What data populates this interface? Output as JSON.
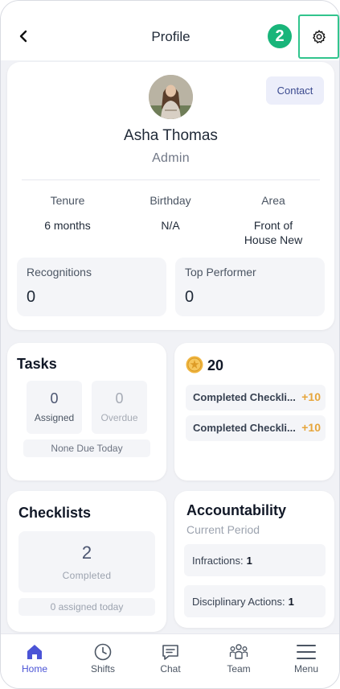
{
  "header": {
    "title": "Profile",
    "step_badge": "2",
    "back_icon": "chevron-left-icon",
    "settings_icon": "gear-icon"
  },
  "profile": {
    "name": "Asha Thomas",
    "role": "Admin",
    "contact_label": "Contact",
    "info": [
      {
        "label": "Tenure",
        "value": "6 months"
      },
      {
        "label": "Birthday",
        "value": "N/A"
      },
      {
        "label": "Area",
        "value": "Front of House New"
      }
    ],
    "stats": [
      {
        "label": "Recognitions",
        "value": "0"
      },
      {
        "label": "Top Performer",
        "value": "0"
      }
    ]
  },
  "tasks": {
    "title": "Tasks",
    "assigned": {
      "value": "0",
      "label": "Assigned"
    },
    "overdue": {
      "value": "0",
      "label": "Overdue"
    },
    "none_due": "None Due Today"
  },
  "points": {
    "total": "20",
    "rows": [
      {
        "label": "Completed Checkli...",
        "value": "+10"
      },
      {
        "label": "Completed Checkli...",
        "value": "+10"
      }
    ]
  },
  "checklists": {
    "title": "Checklists",
    "completed_value": "2",
    "completed_label": "Completed",
    "assigned_today": "0 assigned today"
  },
  "accountability": {
    "title": "Accountability",
    "subtitle": "Current Period",
    "rows": [
      {
        "label": "Infractions:",
        "value": "1"
      },
      {
        "label": "Disciplinary Actions:",
        "value": "1"
      }
    ]
  },
  "nav": {
    "items": [
      {
        "label": "Home",
        "icon": "home-icon",
        "active": true
      },
      {
        "label": "Shifts",
        "icon": "clock-icon"
      },
      {
        "label": "Chat",
        "icon": "chat-icon"
      },
      {
        "label": "Team",
        "icon": "team-icon"
      },
      {
        "label": "Menu",
        "icon": "menu-icon"
      }
    ]
  },
  "colors": {
    "accent": "#4b54d6",
    "badge_green": "#19b57a",
    "points_gold": "#e6a53a"
  }
}
